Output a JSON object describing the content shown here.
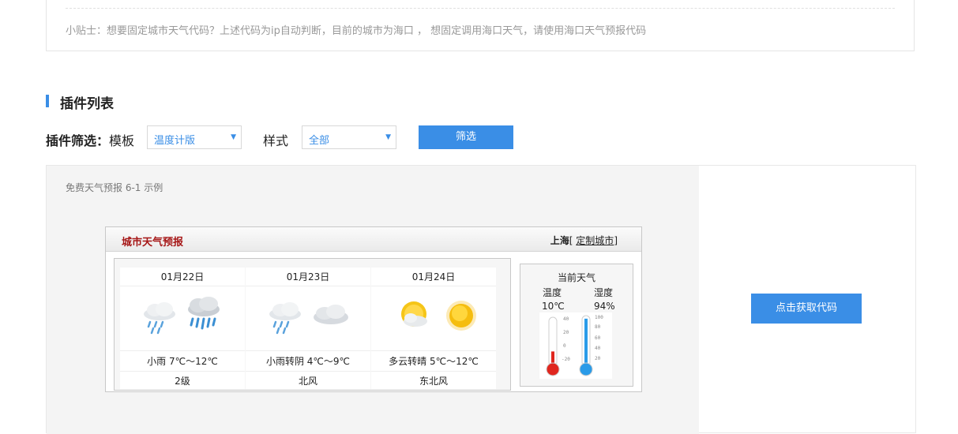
{
  "tip": {
    "text": "小贴士：想要固定城市天气代码？上述代码为ip自动判断，目前的城市为海口 ， 想固定调用海口天气，请使用海口天气预报代码"
  },
  "section": {
    "title": "插件列表"
  },
  "filter": {
    "label": "插件筛选：",
    "template_label": "模板",
    "template_value": "温度计版",
    "style_label": "样式",
    "style_value": "全部",
    "button_label": "筛选"
  },
  "demo": {
    "caption": "免费天气预报 6-1 示例",
    "get_code_button": "点击获取代码",
    "widget": {
      "title": "城市天气预报",
      "city": "上海",
      "bracket_open": "[",
      "custom_city_link": "定制城市",
      "bracket_close": "]",
      "forecast": [
        {
          "date": "01月22日",
          "desc": "小雨 7℃～12℃",
          "wind": "2级",
          "icons": [
            "light-rain-icon",
            "heavy-rain-icon"
          ]
        },
        {
          "date": "01月23日",
          "desc": "小雨转阴 4℃～9℃",
          "wind": "北风",
          "icons": [
            "light-rain-icon",
            "overcast-icon"
          ]
        },
        {
          "date": "01月24日",
          "desc": "多云转晴 5℃～12℃",
          "wind": "东北风",
          "icons": [
            "partly-cloudy-icon",
            "sunny-icon"
          ]
        }
      ],
      "current": {
        "title": "当前天气",
        "temp_label": "温度",
        "humidity_label": "湿度",
        "temp_value": "10℃",
        "humidity_value": "94%",
        "temp_level": 0.3,
        "humidity_level": 0.94,
        "temp_scale": [
          "40",
          "20",
          "0",
          "-20"
        ],
        "humidity_scale": [
          "100",
          "80",
          "60",
          "40",
          "20"
        ]
      }
    }
  },
  "colors": {
    "accent": "#3a8ee6",
    "widget_title": "#a61717",
    "thermo_red": "#e0261e",
    "thermo_blue": "#2a9be8"
  }
}
